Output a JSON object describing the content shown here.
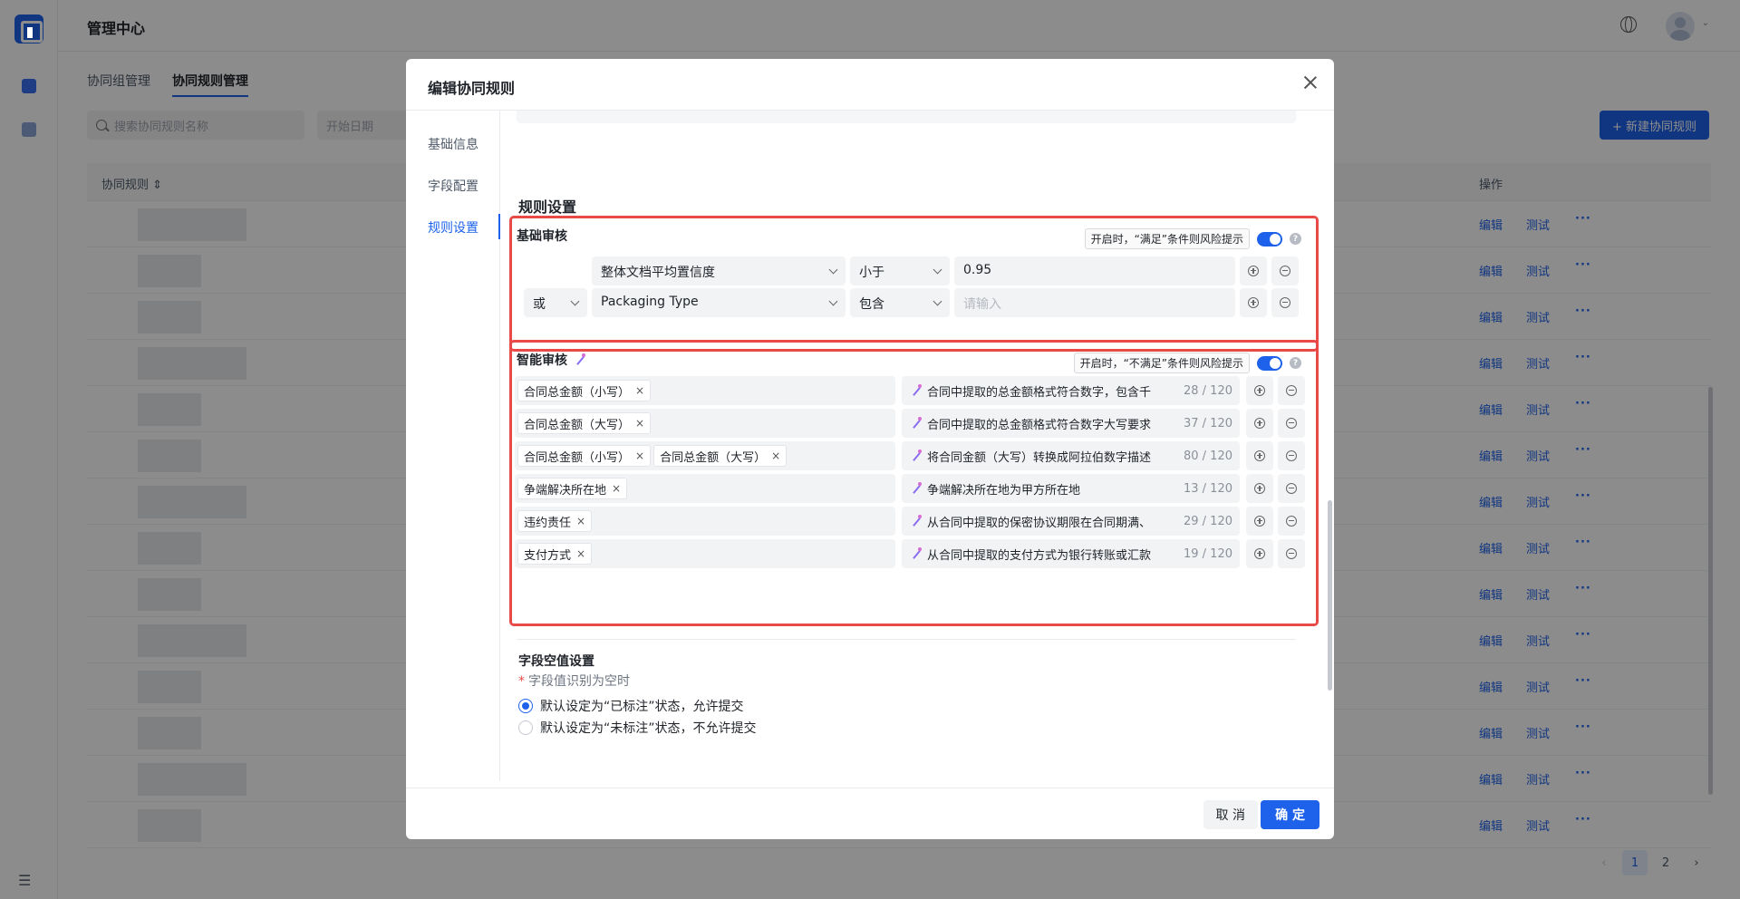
{
  "app": {
    "title": "管理中心"
  },
  "tabs": [
    "协同组管理",
    "协同规则管理"
  ],
  "toolbar": {
    "search_placeholder": "搜索协同规则名称",
    "date_placeholder": "开始日期",
    "new_button": "+ 新建协同规则"
  },
  "table": {
    "col_rule": "协同规则 ⇕",
    "col_actions": "操作",
    "row_actions": {
      "edit": "编辑",
      "test": "测试",
      "more": "···"
    }
  },
  "pagination": {
    "prev": "‹",
    "pages": [
      "1",
      "2"
    ],
    "next": "›",
    "current": "1"
  },
  "modal": {
    "title": "编辑协同规则",
    "nav": [
      "基础信息",
      "字段配置",
      "规则设置"
    ],
    "nav_active": "规则设置",
    "section_title": "规则设置",
    "basic": {
      "title": "基础审核",
      "hint": "开启时，“满足”条件则风险提示",
      "enabled": true,
      "conditions": [
        {
          "logic": "",
          "field": "整体文档平均置信度",
          "operator": "小于",
          "value": "0.95",
          "placeholder": ""
        },
        {
          "logic": "或",
          "field": "Packaging Type",
          "operator": "包含",
          "value": "",
          "placeholder": "请输入"
        }
      ]
    },
    "smart": {
      "title": "智能审核",
      "hint": "开启时，“不满足”条件则风险提示",
      "enabled": true,
      "rules": [
        {
          "tags": [
            "合同总金额（小写）"
          ],
          "desc": "合同中提取的总金额格式符合数字，包含千",
          "count": "28 / 120"
        },
        {
          "tags": [
            "合同总金额（大写）"
          ],
          "desc": "合同中提取的总金额格式符合数字大写要求",
          "count": "37 / 120"
        },
        {
          "tags": [
            "合同总金额（小写）",
            "合同总金额（大写）"
          ],
          "desc": "将合同金额（大写）转换成阿拉伯数字描述",
          "count": "80 / 120"
        },
        {
          "tags": [
            "争端解决所在地"
          ],
          "desc": "争端解决所在地为甲方所在地",
          "count": "13 / 120"
        },
        {
          "tags": [
            "违约责任"
          ],
          "desc": "从合同中提取的保密协议期限在合同期满、",
          "count": "29 / 120"
        },
        {
          "tags": [
            "支付方式"
          ],
          "desc": "从合同中提取的支付方式为银行转账或汇款",
          "count": "19 / 120"
        }
      ]
    },
    "null_setting": {
      "title": "字段空值设置",
      "label": "字段值识别为空时",
      "options": [
        "默认设定为“已标注”状态，允许提交",
        "默认设定为“未标注”状态，不允许提交"
      ],
      "selected": 0
    },
    "footer": {
      "cancel": "取 消",
      "ok": "确 定"
    }
  }
}
